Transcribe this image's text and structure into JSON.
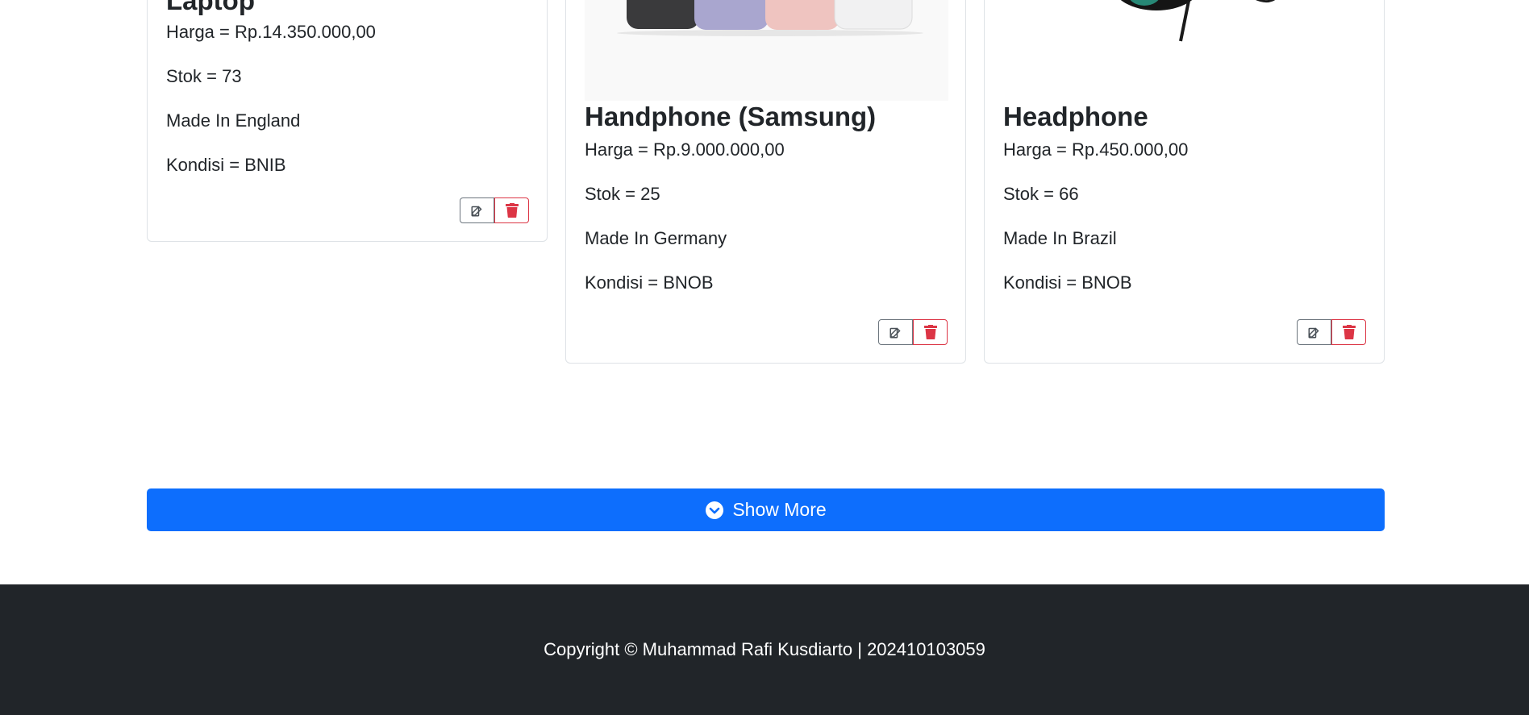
{
  "products": [
    {
      "title": "Laptop",
      "price": "Harga = Rp.14.350.000,00",
      "stock": "Stok = 73",
      "origin": "Made In England",
      "condition": "Kondisi = BNIB"
    },
    {
      "title": "Handphone (Samsung)",
      "price": "Harga = Rp.9.000.000,00",
      "stock": "Stok = 25",
      "origin": "Made In Germany",
      "condition": "Kondisi = BNOB"
    },
    {
      "title": "Headphone",
      "price": "Harga = Rp.450.000,00",
      "stock": "Stok = 66",
      "origin": "Made In Brazil",
      "condition": "Kondisi = BNOB"
    }
  ],
  "icons": {
    "edit": "edit-icon",
    "delete": "trash-icon",
    "show_more": "chevron-circle-down-icon"
  },
  "show_more_label": "Show More",
  "footer_text": "Copyright © Muhammad Rafi Kusdiarto | 202410103059",
  "colors": {
    "primary": "#0d6efd",
    "danger": "#dc3545",
    "secondary": "#6c757d",
    "footer_bg": "#212529"
  }
}
